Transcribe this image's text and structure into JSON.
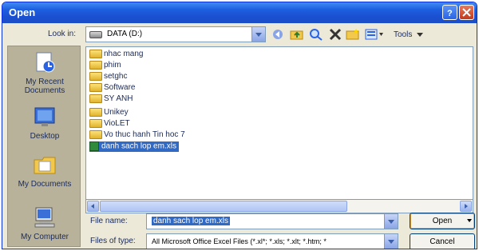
{
  "window": {
    "title": "Open"
  },
  "lookin": {
    "label": "Look in:",
    "value": "DATA (D:)"
  },
  "toolbar": {
    "tools_label": "Tools"
  },
  "places": [
    {
      "label": "My Recent Documents",
      "icon": "recent-documents-icon"
    },
    {
      "label": "Desktop",
      "icon": "desktop-icon"
    },
    {
      "label": "My Documents",
      "icon": "my-documents-icon"
    },
    {
      "label": "My Computer",
      "icon": "my-computer-icon"
    }
  ],
  "files": [
    {
      "name": "nhac mang",
      "type": "folder"
    },
    {
      "name": "phim",
      "type": "folder"
    },
    {
      "name": "setghc",
      "type": "folder"
    },
    {
      "name": "Software",
      "type": "folder"
    },
    {
      "name": "SY ANH",
      "type": "folder"
    },
    {
      "name": "Unikey",
      "type": "folder"
    },
    {
      "name": "VioLET",
      "type": "folder"
    },
    {
      "name": "Vo thuc hanh Tin hoc 7",
      "type": "folder"
    },
    {
      "name": "danh sach lop em.xls",
      "type": "excel",
      "selected": true
    }
  ],
  "filename": {
    "label": "File name:",
    "value": "danh sach lop em.xls"
  },
  "filetype": {
    "label": "Files of type:",
    "value": "All Microsoft Office Excel Files (*.xl*; *.xls; *.xlt; *.htm; *"
  },
  "buttons": {
    "open": "Open",
    "cancel": "Cancel"
  },
  "colors": {
    "title_bar": "#1d5fe0",
    "selection": "#316ac5",
    "dialog_bg": "#ece9d8"
  }
}
